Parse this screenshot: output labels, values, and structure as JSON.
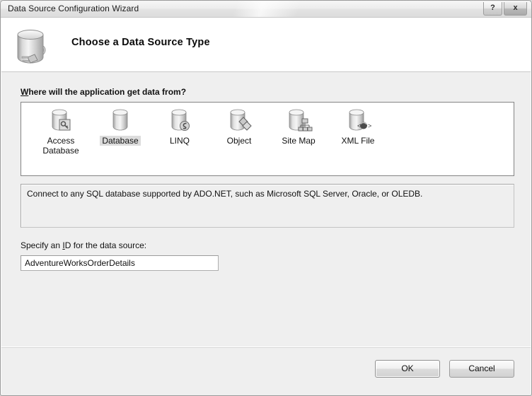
{
  "window": {
    "title": "Data Source Configuration Wizard",
    "help_button": "?",
    "close_button": "x"
  },
  "header": {
    "title": "Choose a Data Source Type",
    "icon": "database-plug-icon"
  },
  "body": {
    "prompt_accel": "W",
    "prompt_rest": "here will the application get data from?",
    "source_types": [
      {
        "label": "Access Database",
        "icon": "access-database-icon",
        "selected": false
      },
      {
        "label": "Database",
        "icon": "database-icon",
        "selected": true
      },
      {
        "label": "LINQ",
        "icon": "linq-icon",
        "selected": false
      },
      {
        "label": "Object",
        "icon": "object-icon",
        "selected": false
      },
      {
        "label": "Site Map",
        "icon": "site-map-icon",
        "selected": false
      },
      {
        "label": "XML File",
        "icon": "xml-file-icon",
        "selected": false
      }
    ],
    "description": "Connect to any SQL database supported by ADO.NET, such as Microsoft SQL Server, Oracle, or OLEDB.",
    "id_label_pre": "Specify an ",
    "id_label_accel": "I",
    "id_label_post": "D for the data source:",
    "id_value": "AdventureWorksOrderDetails",
    "id_placeholder": ""
  },
  "footer": {
    "ok_label": "OK",
    "cancel_label": "Cancel"
  },
  "colors": {
    "dialog_bg": "#efefef",
    "header_bg": "#ffffff",
    "list_bg": "#ffffff",
    "selection_bg": "#dcdcdc",
    "border": "#848484"
  }
}
